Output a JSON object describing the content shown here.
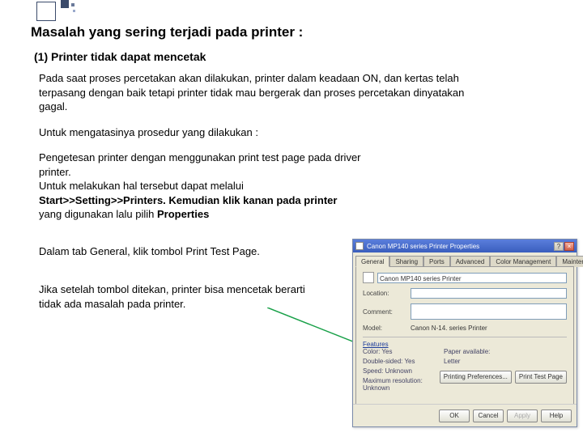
{
  "heading": "Masalah yang sering terjadi pada printer :",
  "subhead": "(1) Printer tidak dapat mencetak",
  "para1": "Pada saat proses  percetakan akan dilakukan, printer dalam keadaan ON, dan kertas telah terpasang dengan baik tetapi printer tidak mau bergerak  dan  proses  percetakan dinyatakan gagal.",
  "para2": "Untuk mengatasinya prosedur yang dilakukan :",
  "para3_a": "Pengetesan printer dengan menggunakan print test page pada driver printer.",
  "para3_b": "Untuk melakukan hal tersebut dapat melalui ",
  "para3_c": "Start>>Setting>>Printers. Kemudian klik  kanan pada printer",
  "para3_d": " yang digunakan lalu pilih ",
  "para3_e": "Properties",
  "para4": "Dalam tab General, klik tombol Print Test Page.",
  "para5": "Jika  setelah tombol ditekan, printer bisa mencetak berarti tidak ada masalah pada printer.",
  "dialog": {
    "title": "Canon MP140 series Printer Properties",
    "tabs": [
      "General",
      "Sharing",
      "Ports",
      "Advanced",
      "Color Management",
      "Maintenance"
    ],
    "printer_name": "Canon MP140 series Printer",
    "labels": {
      "location": "Location:",
      "comment": "Comment:",
      "model": "Model:"
    },
    "model": "Canon  N-14.  series Printer",
    "features_label": "Features",
    "info": {
      "color": {
        "k": "Color: Yes",
        "v": "Paper available:"
      },
      "double": {
        "k": "Double-sided: Yes",
        "v": "Letter"
      },
      "speed": {
        "k": "Speed: Unknown",
        "v": ""
      },
      "res": {
        "k": "Maximum resolution: Unknown",
        "v": ""
      }
    },
    "buttons": {
      "prefs": "Printing Preferences...",
      "test": "Print Test Page",
      "ok": "OK",
      "cancel": "Cancel",
      "apply": "Apply",
      "help": "Help"
    }
  }
}
